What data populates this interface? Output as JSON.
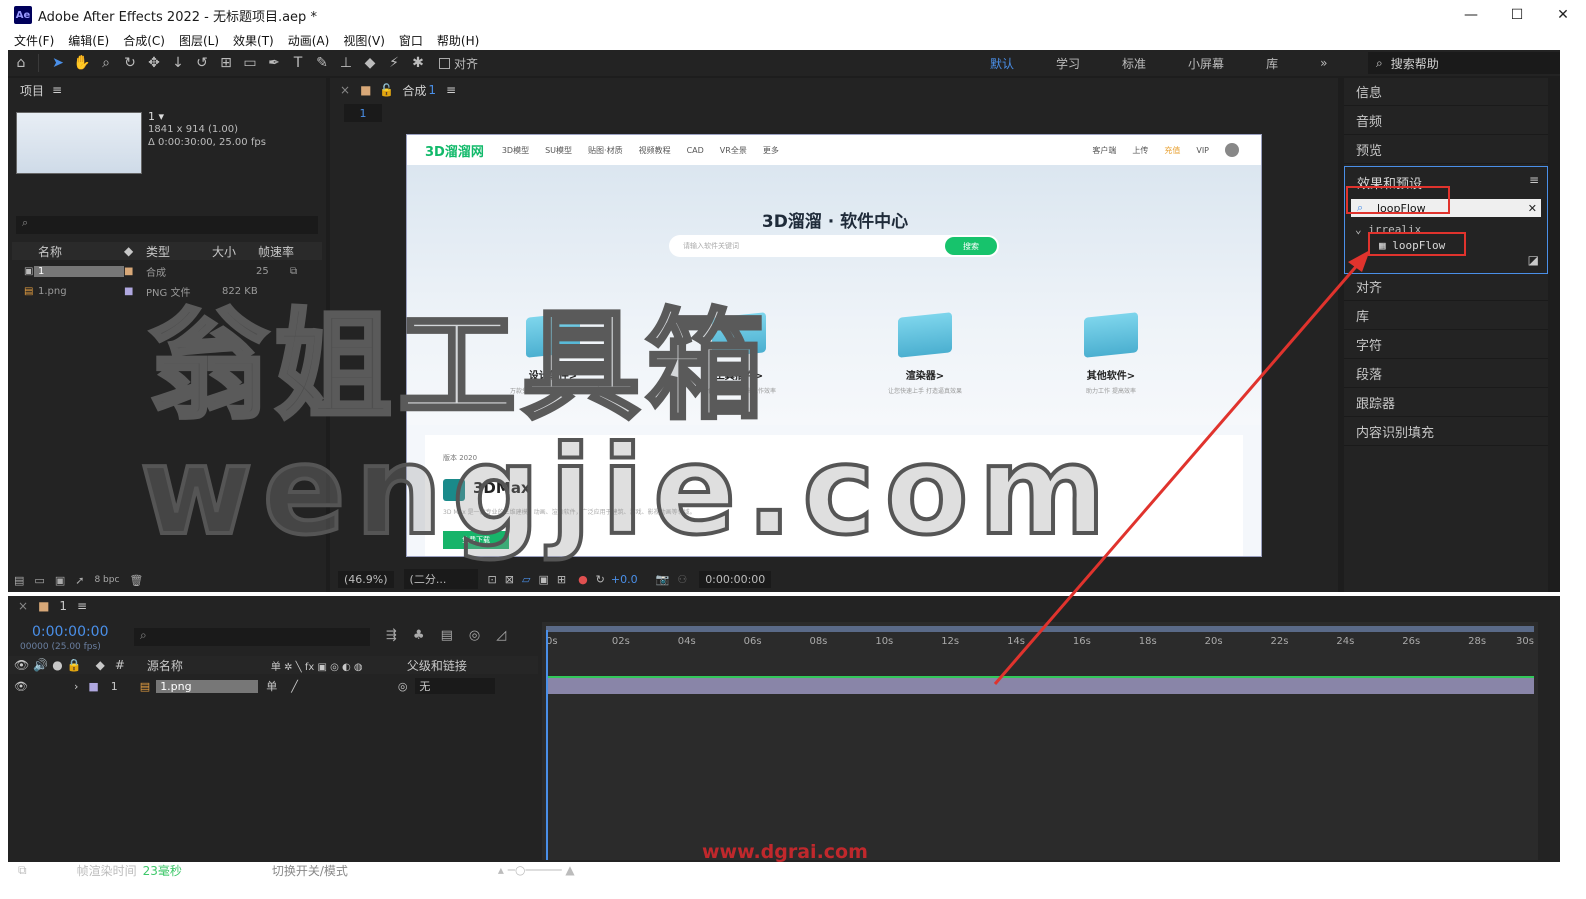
{
  "window": {
    "app_icon": "Ae",
    "title": "Adobe After Effects 2022 - 无标题项目.aep *",
    "minimize": "—",
    "maximize": "☐",
    "close": "✕"
  },
  "menu": [
    "文件(F)",
    "编辑(E)",
    "合成(C)",
    "图层(L)",
    "效果(T)",
    "动画(A)",
    "视图(V)",
    "窗口",
    "帮助(H)"
  ],
  "toolbar": {
    "align_label": "对齐",
    "workspaces": [
      "默认",
      "学习",
      "标准",
      "小屏幕",
      "库"
    ],
    "active_workspace": "默认",
    "overflow": "»",
    "search_help_placeholder": "搜索帮助"
  },
  "project": {
    "title": "项目",
    "comp_name": "1 ▾",
    "comp_size": "1841 x 914 (1.00)",
    "comp_duration": "Δ 0:00:30:00, 25.00 fps",
    "search_placeholder": "",
    "columns": [
      "名称",
      "类型",
      "大小",
      "帧速率"
    ],
    "items": [
      {
        "name": "1",
        "type": "合成",
        "size": "",
        "fps": "25"
      },
      {
        "name": "1.png",
        "type": "PNG 文件",
        "size": "822 KB",
        "fps": ""
      }
    ],
    "bpc": "8 bpc"
  },
  "composition": {
    "tab_label": "合成",
    "tab_num": "1",
    "subtab": "1",
    "zoom": "(46.9%)",
    "resolution": "(二分...",
    "exposure": "+0.0",
    "timecode": "0:00:00:00"
  },
  "webpage": {
    "logo": "3D溜溜网",
    "nav": [
      "3D模型",
      "SU模型",
      "贴图·材质",
      "视频教程",
      "CAD",
      "VR全景",
      "更多"
    ],
    "nav_right": [
      "客户端",
      "上传",
      "充值",
      "VIP"
    ],
    "hero_title": "3D溜溜 · 软件中心",
    "search_placeholder": "请输入软件关键词",
    "search_button": "搜索",
    "categories": [
      {
        "label": "设计软件>",
        "desc": "万款免费设计软件 精选全部资源"
      },
      {
        "label": "工具插件>",
        "desc": "提供各种工具 提高工作效率"
      },
      {
        "label": "渲染器>",
        "desc": "让您快速上手 打造逼真效果"
      },
      {
        "label": "其他软件>",
        "desc": "助力工作 提高效率"
      }
    ],
    "card_version": "版本  2020",
    "card_title": "3DMax",
    "card_desc": "3D Max 是一款专业的三维建模、动画、渲染软件，广泛应用于建筑、游戏、影视动画等领域。",
    "card_button": "免费下载"
  },
  "watermarks": {
    "line1": "翁姐工具箱",
    "line2": "wengjie.com",
    "url": "www.dgrai.com"
  },
  "right_panel": {
    "items_top": [
      "信息",
      "音频",
      "预览"
    ],
    "effects_title": "效果和预设",
    "effects_search": "loopFlow",
    "tree_folder": "irrealix",
    "tree_item": "loopFlow",
    "items_bottom": [
      "对齐",
      "库",
      "字符",
      "段落",
      "跟踪器",
      "内容识别填充"
    ]
  },
  "timeline": {
    "tab": "1",
    "timecode": "0:00:00:00",
    "timecode_sub": "00000 (25.00 fps)",
    "columns": [
      "源名称",
      "父级和链接"
    ],
    "layer": {
      "index": "1",
      "name": "1.png",
      "parent": "无"
    },
    "ruler": [
      "0s",
      "02s",
      "04s",
      "06s",
      "08s",
      "10s",
      "12s",
      "14s",
      "16s",
      "18s",
      "20s",
      "22s",
      "24s",
      "26s",
      "28s",
      "30s"
    ],
    "render_label": "帧渲染时间",
    "render_time": "23毫秒",
    "toggle_label": "切换开关/模式"
  },
  "colors": {
    "accent_blue": "#4a8fe8",
    "annotation_red": "#e0332d",
    "panel_bg": "#232323"
  }
}
